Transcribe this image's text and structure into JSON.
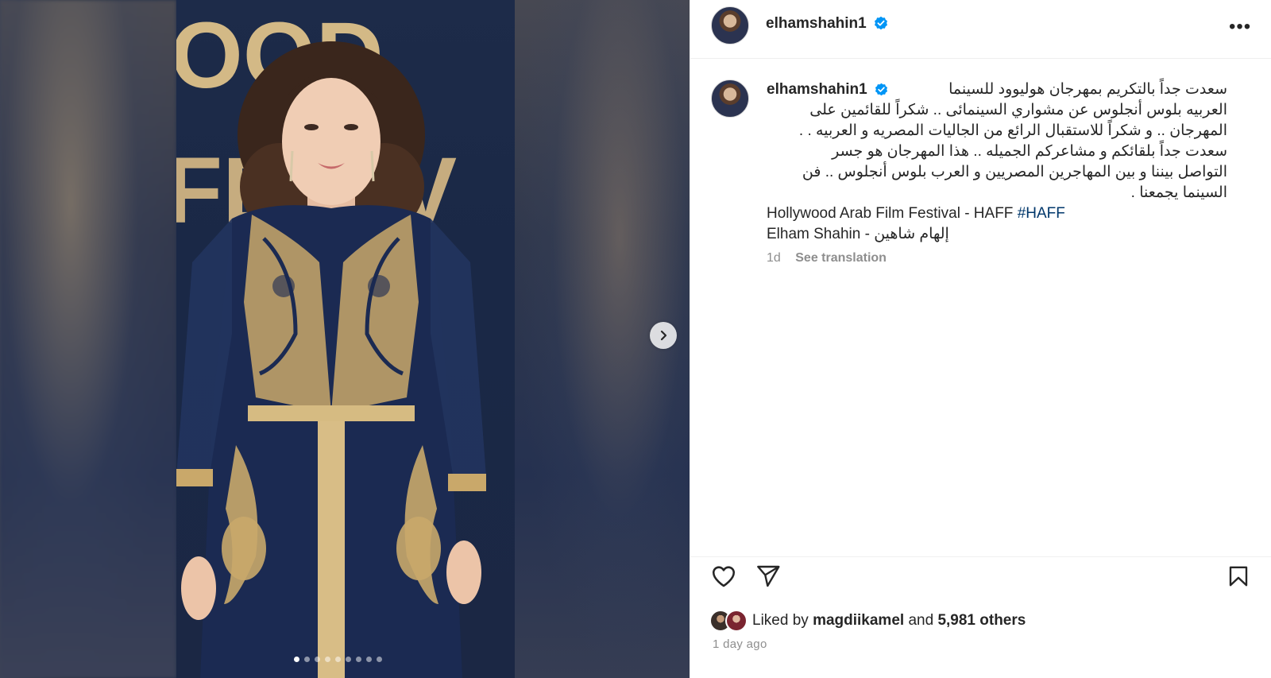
{
  "post": {
    "username": "elhamshahin1",
    "more_label": "•••",
    "caption_ar_lines": [
      "سعدت جداً بالتكريم بمهرجان هوليوود للسينما",
      "العربيه بلوس أنجلوس عن مشواري السينمائى .. شكراً للقائمين على",
      "المهرجان .. و شكراً للاستقبال الرائع من الجاليات المصريه و العربيه . .",
      "سعدت جداً بلقائكم و مشاعركم الجميله .. هذا المهرجان هو جسر",
      "التواصل بيننا و بين المهاجرين المصريين و العرب بلوس أنجلوس .. فن",
      "السينما يجمعنا ."
    ],
    "festival_text": "Hollywood Arab Film Festival - HAFF",
    "hashtag": "#HAFF",
    "name_line": "Elham Shahin - إلهام شاهين",
    "time_short": "1d",
    "see_translation": "See translation",
    "liked_by_prefix": "Liked by",
    "liked_by_user": "magdiikamel",
    "liked_and": "and",
    "liked_others": "5,981 others",
    "time_ago": "1 day ago"
  },
  "media": {
    "backdrop_text_top": "OOD",
    "backdrop_text_mid": "FE  TIV",
    "carousel_count": 9,
    "carousel_active": 1
  },
  "icons": {
    "verified": "verified-badge-icon",
    "like": "heart-icon",
    "share": "send-icon",
    "save": "bookmark-icon",
    "next": "chevron-right-icon"
  },
  "colors": {
    "verified_blue": "#0095f6",
    "hashtag": "#00376b",
    "muted": "#8e8e8e",
    "gold": "#c9a86a",
    "dress_navy": "#1b2a52"
  }
}
